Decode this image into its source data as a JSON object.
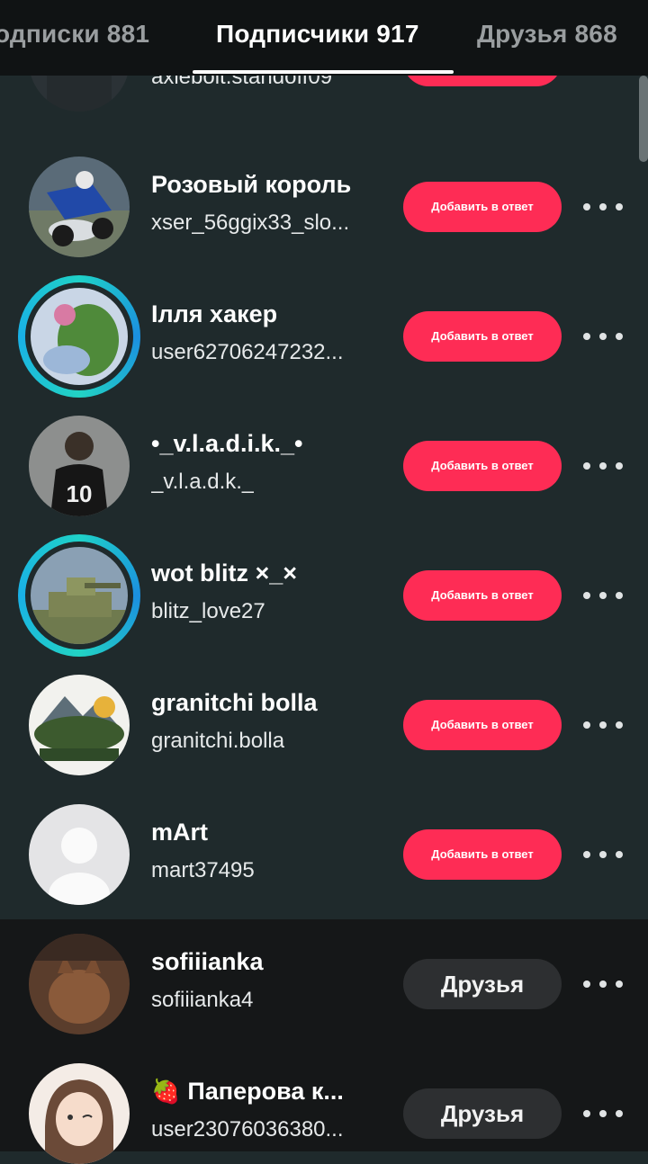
{
  "tabs": [
    {
      "label": "одписки 881",
      "active": false
    },
    {
      "label": "Подписчики 917",
      "active": true
    },
    {
      "label": "Друзья 868",
      "active": false
    }
  ],
  "add_reply_label": "Добавить в ответ",
  "friends_label": "Друзья",
  "rows": [
    {
      "name": "",
      "handle": "axlebolt.standoff09",
      "button": "Добавить в ответ"
    },
    {
      "name": "Розовый король",
      "handle": "xser_56ggix33_slo...",
      "button": "Добавить в ответ"
    },
    {
      "name": "Ілля хакер",
      "handle": "user62706247232...",
      "button": "Добавить в ответ"
    },
    {
      "name": "•_v.l.a.d.i.k._•",
      "handle": "_v.l.a.d.k._",
      "button": "Добавить в ответ"
    },
    {
      "name": "wot blitz  ×_×",
      "handle": "blitz_love27",
      "button": "Добавить в ответ"
    },
    {
      "name": "granitchi bolla",
      "handle": "granitchi.bolla",
      "button": "Добавить в ответ"
    },
    {
      "name": "mArt",
      "handle": "mart37495",
      "button": "Добавить в ответ"
    },
    {
      "name": "sofiiianka",
      "handle": "sofiiianka4",
      "button": "Друзья"
    },
    {
      "name": "Паперова к...",
      "handle": "user23076036380...",
      "button": "Друзья",
      "emoji": "🍓"
    }
  ],
  "colors": {
    "accent": "#fe2c55",
    "story_ring": "#1fd1c8",
    "background": "#1f2a2c",
    "header": "#101314"
  },
  "icons": {
    "more": "more-dots-icon"
  }
}
